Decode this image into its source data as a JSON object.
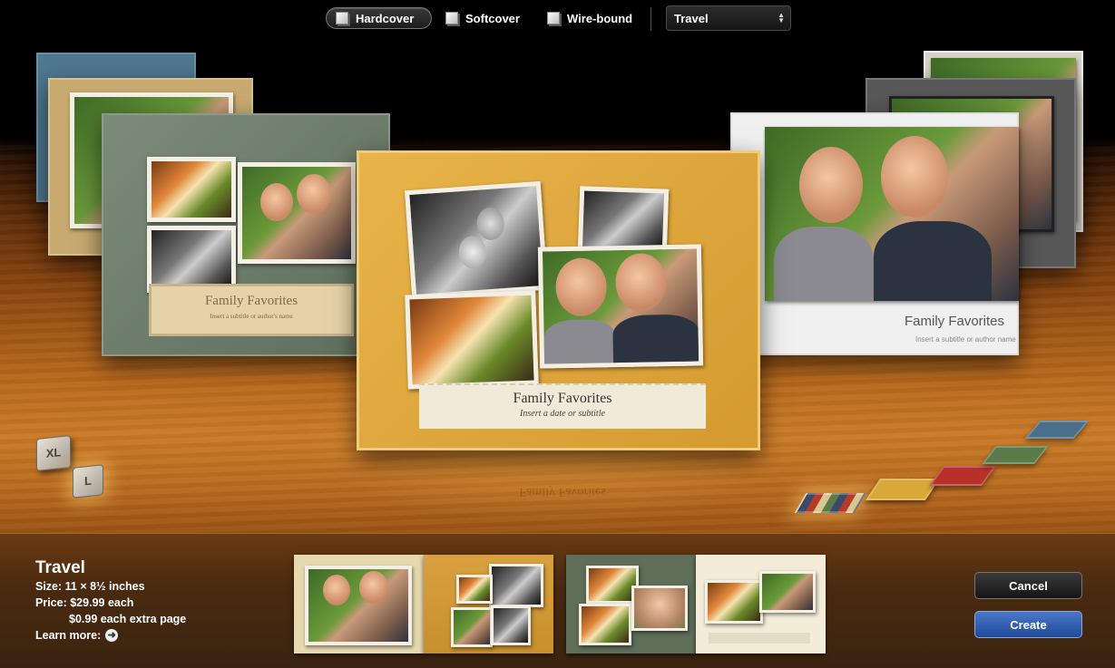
{
  "toolbar": {
    "covers": [
      {
        "label": "Hardcover",
        "selected": true
      },
      {
        "label": "Softcover",
        "selected": false
      },
      {
        "label": "Wire-bound",
        "selected": false
      }
    ],
    "theme_select": {
      "value": "Travel"
    }
  },
  "carousel": {
    "center_book": {
      "title": "Family Favorites",
      "subtitle": "Insert a date or subtitle",
      "cover_color": "#e0a838"
    },
    "left_book": {
      "title": "Family Favorites",
      "subtitle": "Insert a subtitle or author's name",
      "cover_color": "#6e7e6c"
    },
    "right_book": {
      "title": "Family Favorites",
      "subtitle": "Insert a subtitle or author name",
      "cover_color": "#e8e8e8"
    }
  },
  "size_buttons": [
    {
      "label": "XL"
    },
    {
      "label": "L"
    }
  ],
  "color_swatches": [
    "#4a6f8a",
    "#5a7a4a",
    "#b8302a",
    "#d8a838",
    "multicolor"
  ],
  "details": {
    "theme_name": "Travel",
    "size_label": "Size:",
    "size_value": "11 × 8½ inches",
    "price_label": "Price:",
    "price_value": "$29.99 each",
    "extra_page_price": "$0.99 each extra page",
    "learn_more": "Learn more:"
  },
  "buttons": {
    "cancel": "Cancel",
    "create": "Create"
  },
  "colors": {
    "accent_blue": "#2a5aa8",
    "wood": "#c97a26"
  }
}
